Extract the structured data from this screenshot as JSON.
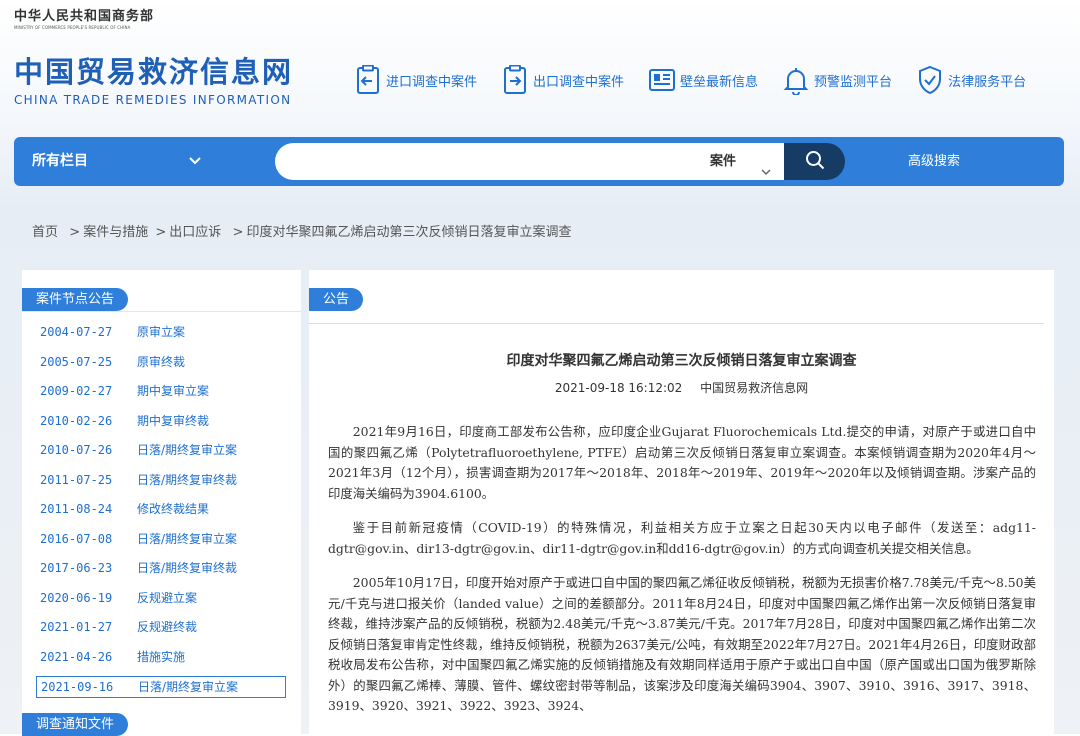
{
  "header": {
    "ministry_cn": "中华人民共和国商务部",
    "ministry_en": "MINISTRY OF COMMERCE PEOPLE'S REPUBLIC OF CHINA",
    "logo_cn": "中国贸易救济信息网",
    "logo_en": "CHINA TRADE REMEDIES INFORMATION"
  },
  "topnav": [
    {
      "label": "进口调查中案件",
      "icon": "document-in-icon"
    },
    {
      "label": "出口调查中案件",
      "icon": "document-out-icon"
    },
    {
      "label": "壁垒最新信息",
      "icon": "news-icon"
    },
    {
      "label": "预警监测平台",
      "icon": "bell-icon"
    },
    {
      "label": "法律服务平台",
      "icon": "shield-check-icon"
    }
  ],
  "search": {
    "scope_label": "所有栏目",
    "placeholder": "",
    "type_label": "案件",
    "advanced_label": "高级搜索"
  },
  "breadcrumb": [
    "首页",
    "案件与措施",
    "出口应诉",
    "印度对华聚四氟乙烯启动第三次反倾销日落复审立案调查"
  ],
  "sidebar": {
    "section1_title": "案件节点公告",
    "section2_title": "调查通知文件",
    "nodes": [
      {
        "date": "2004-07-27",
        "title": "原审立案"
      },
      {
        "date": "2005-07-25",
        "title": "原审终裁"
      },
      {
        "date": "2009-02-27",
        "title": "期中复审立案"
      },
      {
        "date": "2010-02-26",
        "title": "期中复审终裁"
      },
      {
        "date": "2010-07-26",
        "title": "日落/期终复审立案"
      },
      {
        "date": "2011-07-25",
        "title": "日落/期终复审终裁"
      },
      {
        "date": "2011-08-24",
        "title": "修改终裁结果"
      },
      {
        "date": "2016-07-08",
        "title": "日落/期终复审立案"
      },
      {
        "date": "2017-06-23",
        "title": "日落/期终复审终裁"
      },
      {
        "date": "2020-06-19",
        "title": "反规避立案"
      },
      {
        "date": "2021-01-27",
        "title": "反规避终裁"
      },
      {
        "date": "2021-04-26",
        "title": "措施实施"
      },
      {
        "date": "2021-09-16",
        "title": "日落/期终复审立案"
      }
    ]
  },
  "article": {
    "section_label": "公告",
    "title": "印度对华聚四氟乙烯启动第三次反倾销日落复审立案调查",
    "datetime": "2021-09-18 16:12:02",
    "source": "中国贸易救济信息网",
    "paragraphs": [
      "2021年9月16日，印度商工部发布公告称，应印度企业Gujarat Fluorochemicals Ltd.提交的申请，对原产于或进口自中国的聚四氟乙烯（Polytetrafluoroethylene, PTFE）启动第三次反倾销日落复审立案调查。本案倾销调查期为2020年4月～2021年3月（12个月），损害调查期为2017年～2018年、2018年～2019年、2019年～2020年以及倾销调查期。涉案产品的印度海关编码为3904.6100。",
      "鉴于目前新冠疫情（COVID-19）的特殊情况，利益相关方应于立案之日起30天内以电子邮件（发送至：adg11-dgtr@gov.in、dir13-dgtr@gov.in、dir11-dgtr@gov.in和dd16-dgtr@gov.in）的方式向调查机关提交相关信息。",
      "2005年10月17日，印度开始对原产于或进口自中国的聚四氟乙烯征收反倾销税，税额为无损害价格7.78美元/千克～8.50美元/千克与进口报关价（landed value）之间的差额部分。2011年8月24日，印度对中国聚四氟乙烯作出第一次反倾销日落复审终裁，维持涉案产品的反倾销税，税额为2.48美元/千克～3.87美元/千克。2017年7月28日，印度对中国聚四氟乙烯作出第二次反倾销日落复审肯定性终裁，维持反倾销税，税额为2637美元/公吨，有效期至2022年7月27日。2021年4月26日，印度财政部税收局发布公告称，对中国聚四氟乙烯实施的反倾销措施及有效期同样适用于原产于或出口自中国（原产国或出口国为俄罗斯除外）的聚四氟乙烯棒、薄膜、管件、螺纹密封带等制品，该案涉及印度海关编码3904、3907、3910、3916、3917、3918、3919、3920、3921、3922、3923、3924、"
    ]
  },
  "colors": {
    "brand_blue": "#2f7fda",
    "dark_navy": "#163c65",
    "link_blue": "#1f6fd0"
  }
}
